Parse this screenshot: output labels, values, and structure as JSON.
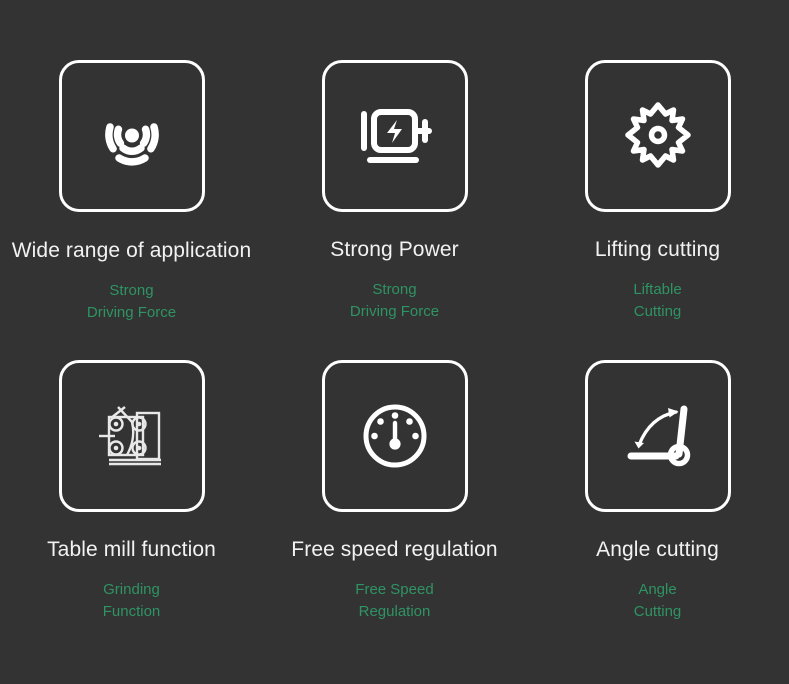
{
  "page": {
    "background_color": "#333333",
    "title_color": "#f2f2f2",
    "subtitle_color": "#2e9463",
    "icon_color": "#ffffff"
  },
  "features": [
    {
      "icon": "wifi-signal-icon",
      "title": "Wide range of application",
      "sub_line_1": "Strong",
      "sub_line_2": "Driving Force"
    },
    {
      "icon": "electric-motor-icon",
      "title": "Strong Power",
      "sub_line_1": "Strong",
      "sub_line_2": "Driving Force"
    },
    {
      "icon": "saw-blade-icon",
      "title": "Lifting cutting",
      "sub_line_1": "Liftable",
      "sub_line_2": "Cutting"
    },
    {
      "icon": "milling-table-icon",
      "title": "Table mill function",
      "sub_line_1": "Grinding",
      "sub_line_2": "Function"
    },
    {
      "icon": "speed-gauge-icon",
      "title": "Free speed regulation",
      "sub_line_1": "Free Speed",
      "sub_line_2": "Regulation"
    },
    {
      "icon": "angle-protractor-icon",
      "title": "Angle cutting",
      "sub_line_1": "Angle",
      "sub_line_2": "Cutting"
    }
  ]
}
